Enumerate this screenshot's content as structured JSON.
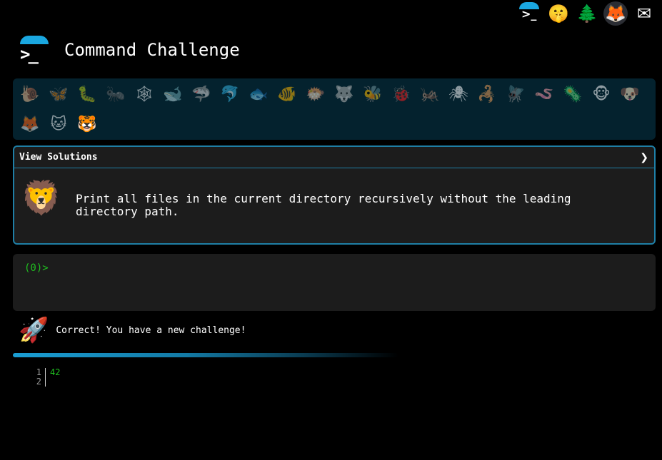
{
  "topbar": {
    "icons": [
      {
        "name": "command-challenge-mini-logo",
        "glyph": ">_"
      },
      {
        "name": "shushing-face-icon",
        "glyph": "🤫"
      },
      {
        "name": "tree-icon",
        "glyph": "🌲"
      },
      {
        "name": "gitlab-icon",
        "glyph": "🦊"
      },
      {
        "name": "mail-icon",
        "glyph": "✉"
      }
    ]
  },
  "header": {
    "logo_prompt": ">_",
    "title": "Command Challenge"
  },
  "animals": [
    {
      "name": "snail",
      "glyph": "🐌"
    },
    {
      "name": "butterfly",
      "glyph": "🦋"
    },
    {
      "name": "caterpillar",
      "glyph": "🐛"
    },
    {
      "name": "ant",
      "glyph": "🐜"
    },
    {
      "name": "spider-web",
      "glyph": "🕸"
    },
    {
      "name": "whale",
      "glyph": "🐋"
    },
    {
      "name": "shark",
      "glyph": "🦈"
    },
    {
      "name": "dolphin",
      "glyph": "🐬"
    },
    {
      "name": "fish",
      "glyph": "🐟"
    },
    {
      "name": "tropical-fish",
      "glyph": "🐠"
    },
    {
      "name": "blowfish",
      "glyph": "🐡"
    },
    {
      "name": "wolf",
      "glyph": "🐺"
    },
    {
      "name": "bee",
      "glyph": "🐝"
    },
    {
      "name": "ladybug",
      "glyph": "🐞"
    },
    {
      "name": "cricket",
      "glyph": "🦗"
    },
    {
      "name": "spider",
      "glyph": "🕷"
    },
    {
      "name": "scorpion",
      "glyph": "🦂"
    },
    {
      "name": "fly",
      "glyph": "🪰"
    },
    {
      "name": "worm",
      "glyph": "🪱"
    },
    {
      "name": "microbe",
      "glyph": "🦠"
    },
    {
      "name": "monkey",
      "glyph": "🐵"
    },
    {
      "name": "dog",
      "glyph": "🐶"
    },
    {
      "name": "fox",
      "glyph": "🦊"
    },
    {
      "name": "cat",
      "glyph": "🐱"
    },
    {
      "name": "tiger",
      "glyph": "🐯",
      "current": true
    }
  ],
  "solution_card": {
    "toggle_label": "View Solutions",
    "chevron": "❯",
    "challenge_icon": "🦁",
    "challenge_text": "Print all files in the current directory recursively without the leading directory path."
  },
  "terminal": {
    "prompt": "(0)>",
    "input_value": ""
  },
  "result": {
    "icon": "🚀",
    "message": "Correct! You have a new challenge!"
  },
  "output": {
    "lines": [
      {
        "num": "1",
        "text": "42"
      },
      {
        "num": "2",
        "text": ""
      }
    ]
  },
  "colors": {
    "accent": "#1aa7e0",
    "prompt_green": "#20c020",
    "card_border": "#1f7fa6",
    "strip_bg": "#04222e"
  }
}
